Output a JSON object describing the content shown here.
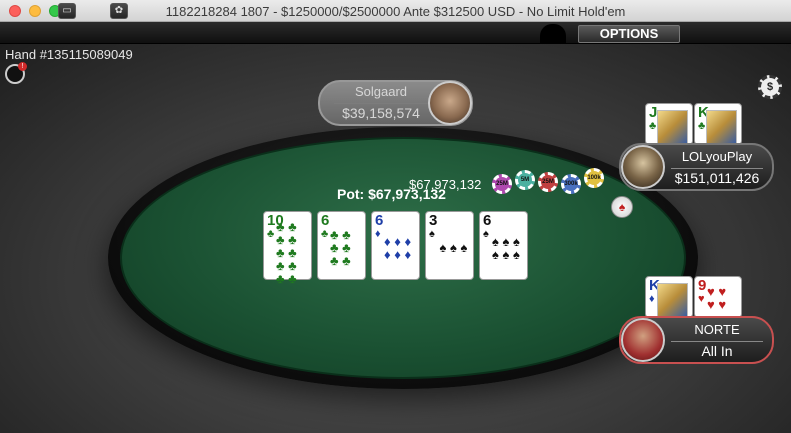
{
  "window": {
    "title": "1182218284 1807 - $1250000/$2500000 Ante $312500 USD - No Limit Hold'em"
  },
  "toolbar": {
    "options_label": "OPTIONS",
    "tile_icon": "tile-windows-icon",
    "color_icon": "color-wheel-icon"
  },
  "hand": {
    "id_label": "Hand #135115089049",
    "badge": "!"
  },
  "cashier": {
    "label": "$"
  },
  "players": {
    "top": {
      "name": "Solgaard",
      "stack": "$39,158,574"
    },
    "right": {
      "name": "LOLyouPlay",
      "stack": "$151,011,426",
      "cards": [
        {
          "rank": "J",
          "suit": "♣",
          "color": "green"
        },
        {
          "rank": "K",
          "suit": "♣",
          "color": "green"
        }
      ]
    },
    "hero": {
      "name": "NORTE",
      "status": "All In",
      "cards": [
        {
          "rank": "K",
          "suit": "♦",
          "color": "blue"
        },
        {
          "rank": "9",
          "suit": "♥",
          "color": "red"
        }
      ]
    }
  },
  "board": [
    {
      "rank": "10",
      "suit": "♣",
      "color": "green"
    },
    {
      "rank": "6",
      "suit": "♣",
      "color": "green"
    },
    {
      "rank": "6",
      "suit": "♦",
      "color": "blue"
    },
    {
      "rank": "3",
      "suit": "♠",
      "color": "black"
    },
    {
      "rank": "6",
      "suit": "♠",
      "color": "black"
    }
  ],
  "pot": {
    "label": "Pot: $67,973,132"
  },
  "bet": {
    "amount": "$67,973,132",
    "chips": [
      {
        "label": "25M",
        "color": "#b04ab0"
      },
      {
        "label": "5M",
        "color": "#4ab0a0"
      },
      {
        "label": "25M",
        "color": "#c04040"
      },
      {
        "label": "300k",
        "color": "#4a70c0"
      },
      {
        "label": "100k",
        "color": "#e0c040"
      }
    ]
  },
  "dealer_button": {
    "label": "♠"
  },
  "colors": {
    "felt": "#1b5233",
    "rail": "#0c0c0c",
    "hero_border": "#c85050"
  }
}
